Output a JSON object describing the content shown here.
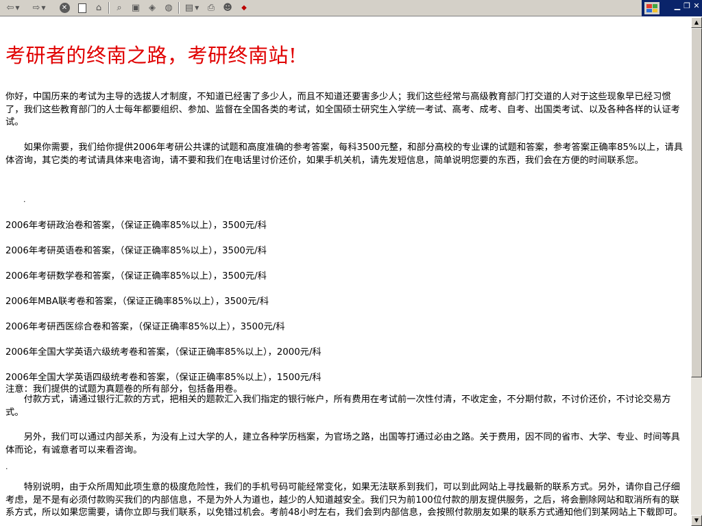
{
  "toolbar": {
    "back_icon": "back-arrow-icon",
    "forward_icon": "forward-arrow-icon",
    "stop_glyph": "✕",
    "icons": [
      "stop-icon",
      "refresh-icon",
      "home-icon",
      "search-icon",
      "favorites-icon",
      "history-icon",
      "mail-icon",
      "edit-icon",
      "print-icon",
      "messenger-icon",
      "tencent-icon"
    ]
  },
  "window": {
    "min_glyph": "▁",
    "restore_glyph": "❐",
    "close_glyph": "✕"
  },
  "page": {
    "title": "考研者的终南之路，考研终南站!",
    "intro": "你好，中国历来的考试为主导的选拔人才制度，不知道已经害了多少人，而且不知道还要害多少人；我们这些经常与高级教育部门打交道的人对于这些现象早已经习惯了，我们这些教育部门的人士每年都要组织、参加、监督在全国各类的考试，如全国硕士研究生入学统一考试、高考、成考、自考、出国类考试、以及各种各样的认证考试。",
    "offer": "　　如果你需要，我们给你提供2006年考研公共课的试题和高度准确的参考答案，每科3500元整，和部分高校的专业课的试题和答案，参考答案正确率85%以上，请具体咨询，其它类的考试请具体来电咨询，请不要和我们在电话里讨价还价，如果手机关机，请先发短信息，简单说明您要的东西，我们会在方便的时间联系您。",
    "products": [
      "2006年考研政治卷和答案，（保证正确率85%以上），3500元/科",
      "2006年考研英语卷和答案，（保证正确率85%以上），3500元/科",
      "2006年考研数学卷和答案，（保证正确率85%以上），3500元/科",
      "2006年MBA联考卷和答案，（保证正确率85%以上），3500元/科",
      "2006年考研西医综合卷和答案，（保证正确率85%以上），3500元/科",
      "2006年全国大学英语六级统考卷和答案，（保证正确率85%以上），2000元/科",
      "2006年全国大学英语四级统考卷和答案，（保证正确率85%以上），1500元/科"
    ],
    "note": "注意：我们提供的试题为真题卷的所有部分，包括备用卷。",
    "payment": "　　付款方式，请通过银行汇款的方式，把相关的题款汇入我们指定的银行帐户，所有费用在考试前一次性付清，不收定金，不分期付款，不讨价还价，不讨论交易方式。",
    "other": "　　另外，我们可以通过内部关系，为没有上过大学的人，建立各种学历档案，为官场之路，出国等打通过必由之路。关于费用，因不同的省市、大学、专业、时间等具体而论，有诚意者可以来看咨询。",
    "special": "　　特别说明，由于众所周知此项生意的极度危险性，我们的手机号码可能经常变化，如果无法联系到我们，可以到此网站上寻找最新的联系方式。另外，请你自己仔细考虑，是不是有必须付款购买我们的内部信息，不是为外人为道也，越少的人知道越安全。我们只为前100位付款的朋友提供服务，之后，将会删除网站和取消所有的联系方式，所以如果您需要，请你立即与我们联系，以免错过机会。考前48小时左右，我们会到内部信息，会按照付款朋友如果的联系方式通知他们到某网站上下载即可。",
    "dot": "."
  },
  "scrollbar": {
    "up_glyph": "▲",
    "down_glyph": "▼"
  }
}
